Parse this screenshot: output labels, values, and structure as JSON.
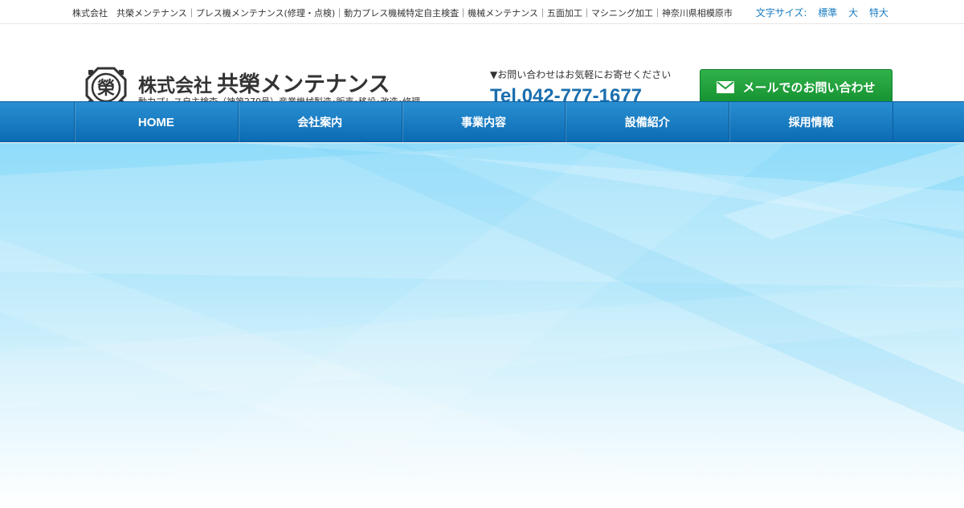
{
  "topbar": {
    "keywords": "株式会社　共榮メンテナンス｜プレス機メンテナンス(修理・点検)｜動力プレス機械特定自主検査｜機械メンテナンス｜五面加工｜マシニング加工｜神奈川県相模原市",
    "font_size_label": "文字サイズ:",
    "font_size_options": [
      "標準",
      "大",
      "特大"
    ]
  },
  "header": {
    "logo_mark_icon": "sakae-logo-icon",
    "company_prefix": "株式会社",
    "company_name": "共榮メンテナンス",
    "tagline": "動力プレス自主検査（神第270号）産業機械製造･販売･移設･改造･修理",
    "contact_note": "▼お問い合わせはお気軽にお寄せください",
    "tel": "Tel.042-777-1677",
    "mail_button_label": "メールでのお問い合わせ",
    "mail_icon": "envelope-icon",
    "accent_green": "#1a9b35",
    "accent_blue": "#1a6fae"
  },
  "nav": {
    "items": [
      "HOME",
      "会社案内",
      "事業内容",
      "設備紹介",
      "採用情報"
    ]
  },
  "hero": {
    "background": "light-blue-gradient"
  }
}
